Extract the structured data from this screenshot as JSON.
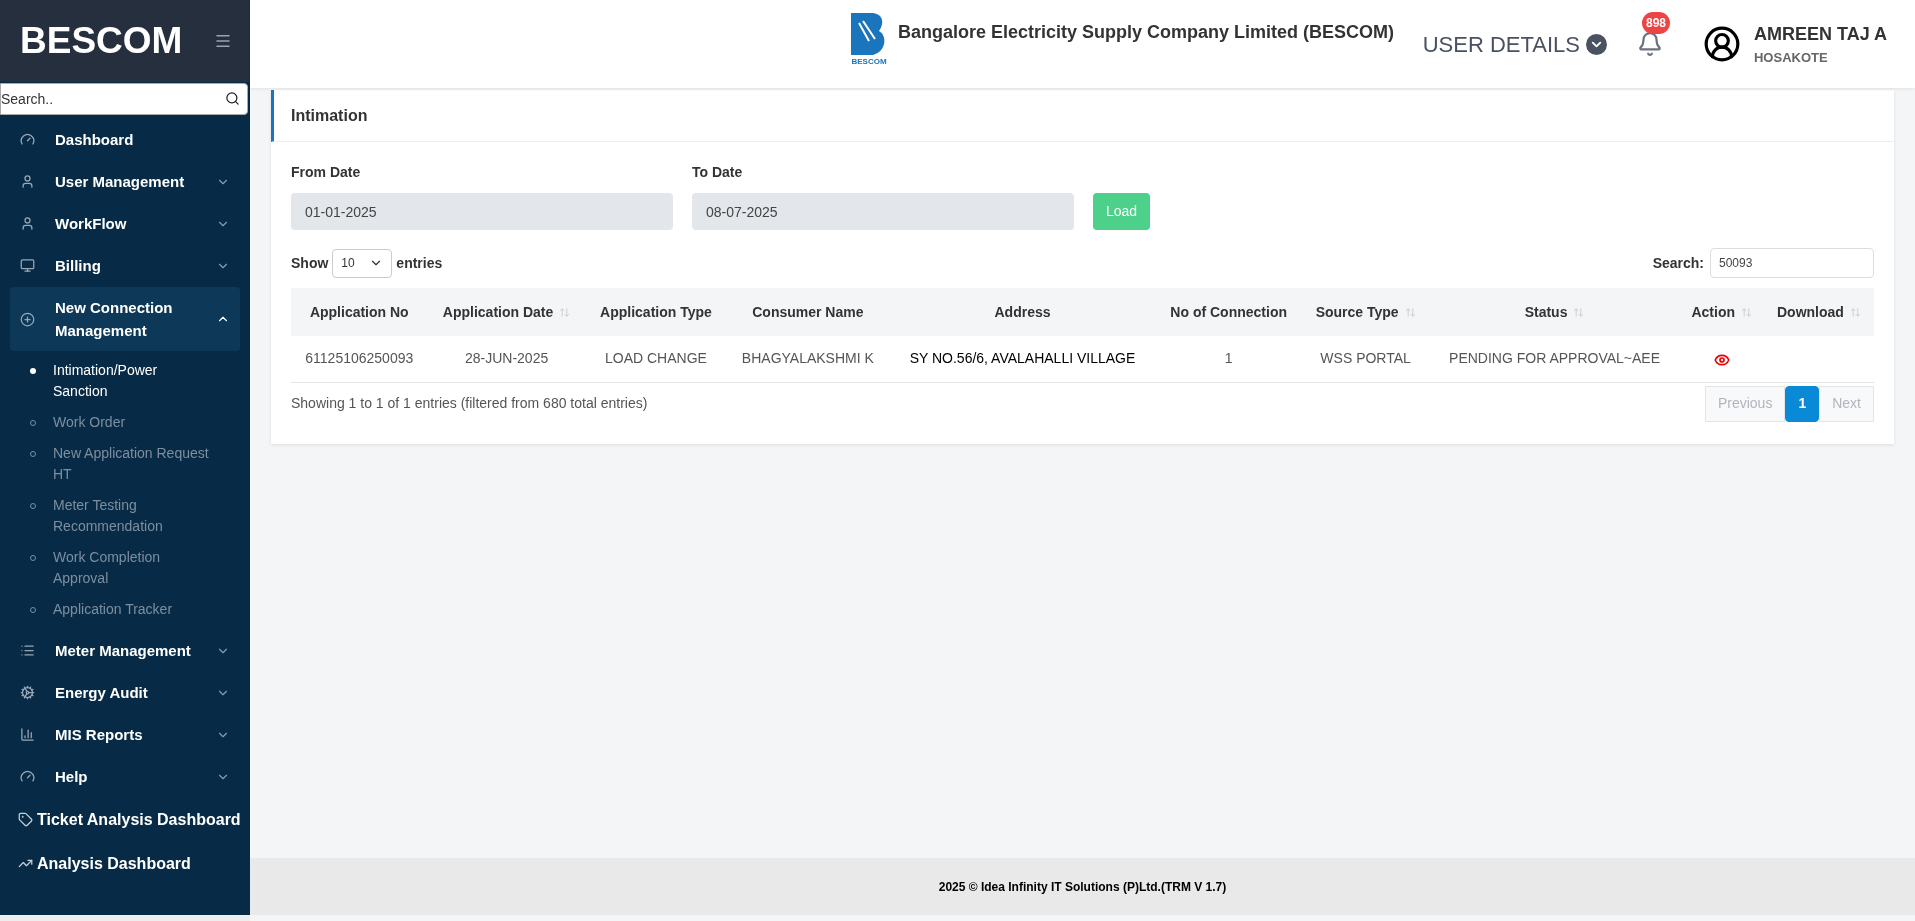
{
  "sidebar": {
    "brand": "BESCOM",
    "search_placeholder": "Search..",
    "items": [
      {
        "label": "Dashboard",
        "kind": "plain",
        "expanded": false
      },
      {
        "label": "User Management",
        "kind": "menu",
        "expanded": false
      },
      {
        "label": "WorkFlow",
        "kind": "menu",
        "expanded": false
      },
      {
        "label": "Billing",
        "kind": "menu",
        "expanded": false
      },
      {
        "label": "New Connection Management",
        "kind": "menu",
        "expanded": true,
        "children": [
          {
            "label": "Intimation/Power Sanction",
            "selected": true
          },
          {
            "label": "Work Order",
            "selected": false
          },
          {
            "label": "New Application Request HT",
            "selected": false
          },
          {
            "label": "Meter Testing Recommendation",
            "selected": false
          },
          {
            "label": "Work Completion Approval",
            "selected": false
          },
          {
            "label": "Application Tracker",
            "selected": false
          }
        ]
      },
      {
        "label": "Meter Management",
        "kind": "menu",
        "expanded": false
      },
      {
        "label": "Energy Audit",
        "kind": "menu",
        "expanded": false
      },
      {
        "label": "MIS Reports",
        "kind": "menu",
        "expanded": false
      },
      {
        "label": "Help",
        "kind": "menu",
        "expanded": false
      },
      {
        "label": "Ticket Analysis Dashboard",
        "kind": "link",
        "expanded": false
      },
      {
        "label": "Analysis Dashboard",
        "kind": "link",
        "expanded": false
      }
    ]
  },
  "header": {
    "logo_caption": "BESCOM",
    "company": "Bangalore Electricity Supply Company Limited (BESCOM)",
    "user_details": "USER DETAILS",
    "notification_count": "898",
    "user_name": "AMREEN TAJ A",
    "user_location": "HOSAKOTE"
  },
  "card": {
    "title": "Intimation",
    "from_date": {
      "label": "From Date",
      "value": "01-01-2025"
    },
    "to_date": {
      "label": "To Date",
      "value": "08-07-2025"
    },
    "load_button": "Load",
    "show_label": "Show",
    "page_size": "10",
    "entries_label": "entries",
    "search_label": "Search:",
    "search_value": "50093",
    "table": {
      "columns": [
        {
          "label": "Application No",
          "sort_icon": false
        },
        {
          "label": "Application Date",
          "sort_icon": true
        },
        {
          "label": "Application Type",
          "sort_icon": false
        },
        {
          "label": "Consumer Name",
          "sort_icon": false
        },
        {
          "label": "Address",
          "sort_icon": false
        },
        {
          "label": "No of Connection",
          "sort_icon": false
        },
        {
          "label": "Source Type",
          "sort_icon": true
        },
        {
          "label": "Status",
          "sort_icon": true
        },
        {
          "label": "Action",
          "sort_icon": true
        },
        {
          "label": "Download",
          "sort_icon": true
        }
      ],
      "rows": [
        {
          "cells": [
            "61125106250093",
            "28-JUN-2025",
            "LOAD CHANGE",
            "BHAGYALAKSHMI K",
            "SY NO.56/6, AVALAHALLI VILLAGE",
            "1",
            "WSS PORTAL",
            "PENDING FOR APPROVAL~AEE"
          ]
        }
      ]
    },
    "info": "Showing 1 to 1 of 1 entries (filtered from 680 total entries)",
    "pagination": [
      {
        "label": "Previous",
        "selected": false,
        "disabled": true
      },
      {
        "label": "1",
        "selected": true,
        "disabled": false
      },
      {
        "label": "Next",
        "selected": false,
        "disabled": true
      }
    ]
  },
  "footer": "2025 © Idea Infinity IT Solutions (P)Ltd.(TRM V 1.7)"
}
